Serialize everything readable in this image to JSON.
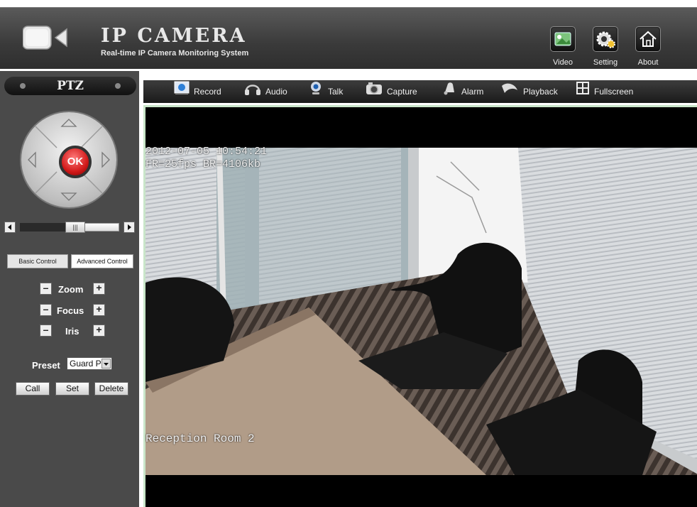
{
  "header": {
    "title": "IP CAMERA",
    "subtitle": "Real-time IP Camera Monitoring System",
    "nav": [
      {
        "label": "Video",
        "icon": "video-icon"
      },
      {
        "label": "Setting",
        "icon": "gear-icon"
      },
      {
        "label": "About",
        "icon": "home-icon"
      }
    ]
  },
  "ptz": {
    "title": "PTZ",
    "ok_label": "OK",
    "tabs": [
      "Basic Control",
      "Advanced Control"
    ],
    "controls": [
      "Zoom",
      "Focus",
      "Iris"
    ],
    "preset_label": "Preset",
    "preset_value": "Guard P",
    "buttons": [
      "Call",
      "Set",
      "Delete"
    ]
  },
  "toolbar": {
    "items": [
      {
        "label": "Record",
        "icon": "record-icon"
      },
      {
        "label": "Audio",
        "icon": "headphones-icon"
      },
      {
        "label": "Talk",
        "icon": "webcam-icon"
      },
      {
        "label": "Capture",
        "icon": "camera-icon"
      },
      {
        "label": "Alarm",
        "icon": "bell-icon"
      },
      {
        "label": "Playback",
        "icon": "playback-icon"
      },
      {
        "label": "Fullscreen",
        "icon": "fullscreen-icon"
      }
    ]
  },
  "video": {
    "timestamp": "2012-07-05 10:54:21",
    "stats": "FR=25fps BR=4106kb",
    "caption": "Reception Room 2"
  }
}
